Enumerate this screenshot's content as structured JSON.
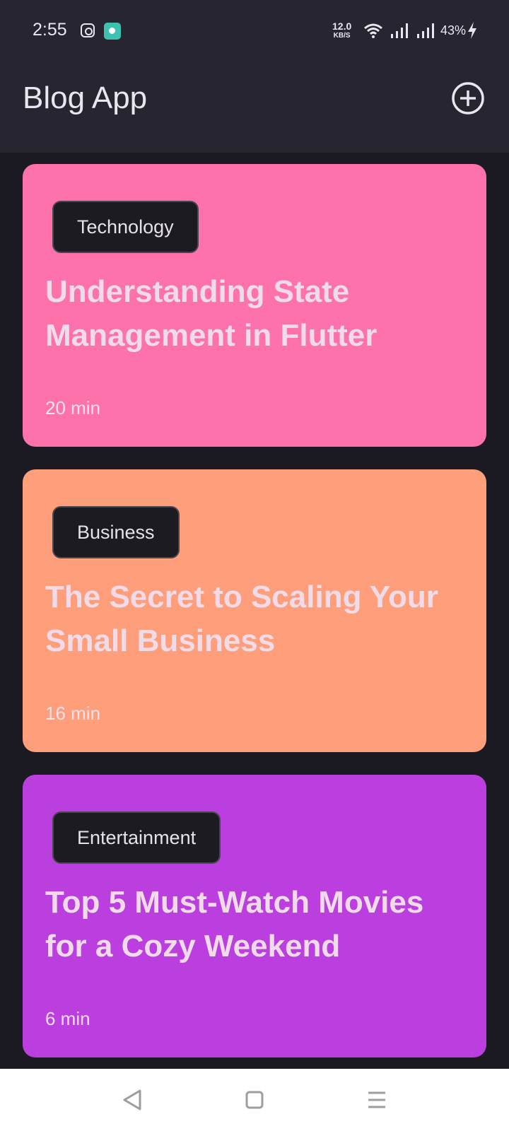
{
  "status_bar": {
    "time": "2:55",
    "net_speed_value": "12.0",
    "net_speed_unit": "KB/S",
    "battery": "43%",
    "icons": [
      "instagram-icon",
      "app-notification-icon",
      "wifi-icon",
      "signal-icon",
      "signal-icon",
      "charging-bolt-icon"
    ]
  },
  "app_bar": {
    "title": "Blog App",
    "add_icon": "add-circle-icon"
  },
  "posts": [
    {
      "category": "Technology",
      "title": "Understanding State Management in Flutter",
      "read_time": "20 min",
      "color": "#fd72ab"
    },
    {
      "category": "Business",
      "title": "The Secret to Scaling Your Small Business",
      "read_time": "16 min",
      "color": "#ff9e7b"
    },
    {
      "category": "Entertainment",
      "title": "Top 5 Must-Watch Movies for a Cozy Weekend",
      "read_time": "6 min",
      "color": "#bb3fdf"
    }
  ],
  "nav_bar": {
    "icons": [
      "back-icon",
      "home-icon",
      "menu-icon"
    ]
  },
  "colors": {
    "background": "#1b1a22",
    "app_bar": "#262530",
    "chip": "#1c1b22"
  }
}
